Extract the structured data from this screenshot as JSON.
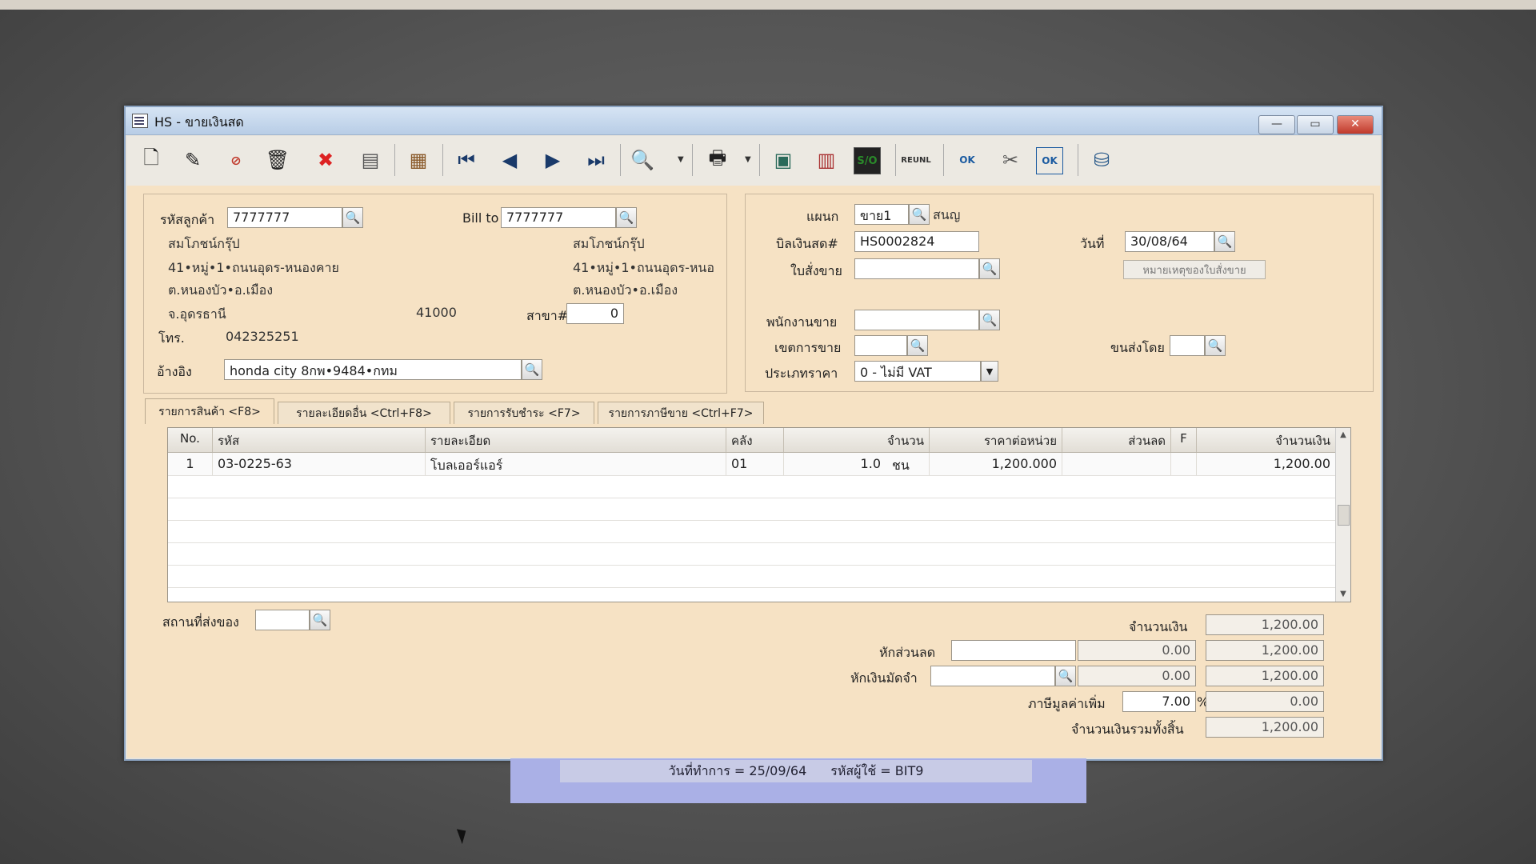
{
  "window": {
    "title": "HS - ขายเงินสด",
    "controls": {
      "minimize": "—",
      "maximize": "▭",
      "close": "✕"
    }
  },
  "toolbar": {
    "icons": [
      "new-document-icon",
      "edit-icon",
      "void-icon",
      "delete-bin-icon",
      "cancel-icon",
      "save-icon",
      "books-icon",
      "first-record-icon",
      "previous-record-icon",
      "next-record-icon",
      "last-record-icon",
      "preview-icon",
      "print-icon",
      "calculator-icon",
      "form-icon",
      "so-icon",
      "reunl-icon",
      "approve-ok-icon",
      "tools-icon",
      "doc-ok-icon",
      "network-icon"
    ],
    "so_label": "S/O",
    "reunl_label": "REUNL",
    "ok_label": "OK"
  },
  "customer": {
    "code_label": "รหัสลูกค้า",
    "code": "7777777",
    "name": "สมโภชน์กรุ๊ป",
    "address1": "41•หมู่•1•ถนนอุดร-หนองคาย",
    "address2": "ต.หนองบัว•อ.เมือง",
    "province": "จ.อุดรธานี",
    "zip": "41000",
    "phone_label": "โทร.",
    "phone": "042325251",
    "reference_label": "อ้างอิง",
    "reference": "honda city 8กพ•9484•กทม"
  },
  "bill_to": {
    "label": "Bill to",
    "code": "7777777",
    "name": "สมโภชน์กรุ๊ป",
    "address1": "41•หมู่•1•ถนนอุดร-หนอ",
    "address2": "ต.หนองบัว•อ.เมือง",
    "branch_label": "สาขา#",
    "branch": "0"
  },
  "doc": {
    "dept_label": "แผนก",
    "dept": "ขาย1",
    "dept_name": "สนญ",
    "bill_label": "บิลเงินสด#",
    "bill_no": "HS0002824",
    "date_label": "วันที่",
    "date": "30/08/64",
    "so_label": "ใบสั่งขาย",
    "so_value": "",
    "so_note_button": "หมายเหตุของใบสั่งขาย",
    "salesman_label": "พนักงานขาย",
    "salesman": "",
    "area_label": "เขตการขาย",
    "area": "",
    "ship_by_label": "ขนส่งโดย",
    "ship_by": "",
    "price_type_label": "ประเภทราคา",
    "price_type": "0 - ไม่มี VAT"
  },
  "tabs": [
    {
      "label": "รายการสินค้า <F8>"
    },
    {
      "label": "รายละเอียดอื่น <Ctrl+F8>"
    },
    {
      "label": "รายการรับชำระ <F7>"
    },
    {
      "label": "รายการภาษีขาย <Ctrl+F7>"
    }
  ],
  "grid": {
    "headers": [
      "No.",
      "รหัส",
      "รายละเอียด",
      "คลัง",
      "จำนวน",
      "ราคาต่อหน่วย",
      "ส่วนลด",
      "F",
      "จำนวนเงิน"
    ],
    "rows": [
      {
        "no": "1",
        "code": "03-0225-63",
        "desc": "โบลเออร์แอร์",
        "wh": "01",
        "qty": "1.0",
        "unit": "ชน",
        "price": "1,200.000",
        "disc": "",
        "f": "",
        "amount": "1,200.00"
      }
    ]
  },
  "footer": {
    "ship_place_label": "สถานที่ส่งของ",
    "ship_place": "",
    "amount_label": "จำนวนเงิน",
    "amount": "1,200.00",
    "discount_label": "หักส่วนลด",
    "discount_input": "",
    "discount_value": "0.00",
    "after_discount": "1,200.00",
    "deposit_label": "หักเงินมัดจำ",
    "deposit_input": "",
    "deposit_value": "0.00",
    "after_deposit": "1,200.00",
    "vat_label": "ภาษีมูลค่าเพิ่ม",
    "vat_rate": "7.00",
    "vat_pct": "%",
    "vat_amount": "0.00",
    "total_label": "จำนวนเงินรวมทั้งสิ้น",
    "total": "1,200.00"
  },
  "status": {
    "work_date": "วันที่ทำการ  =  25/09/64",
    "user": "รหัสผู้ใช้  =  BIT9"
  }
}
